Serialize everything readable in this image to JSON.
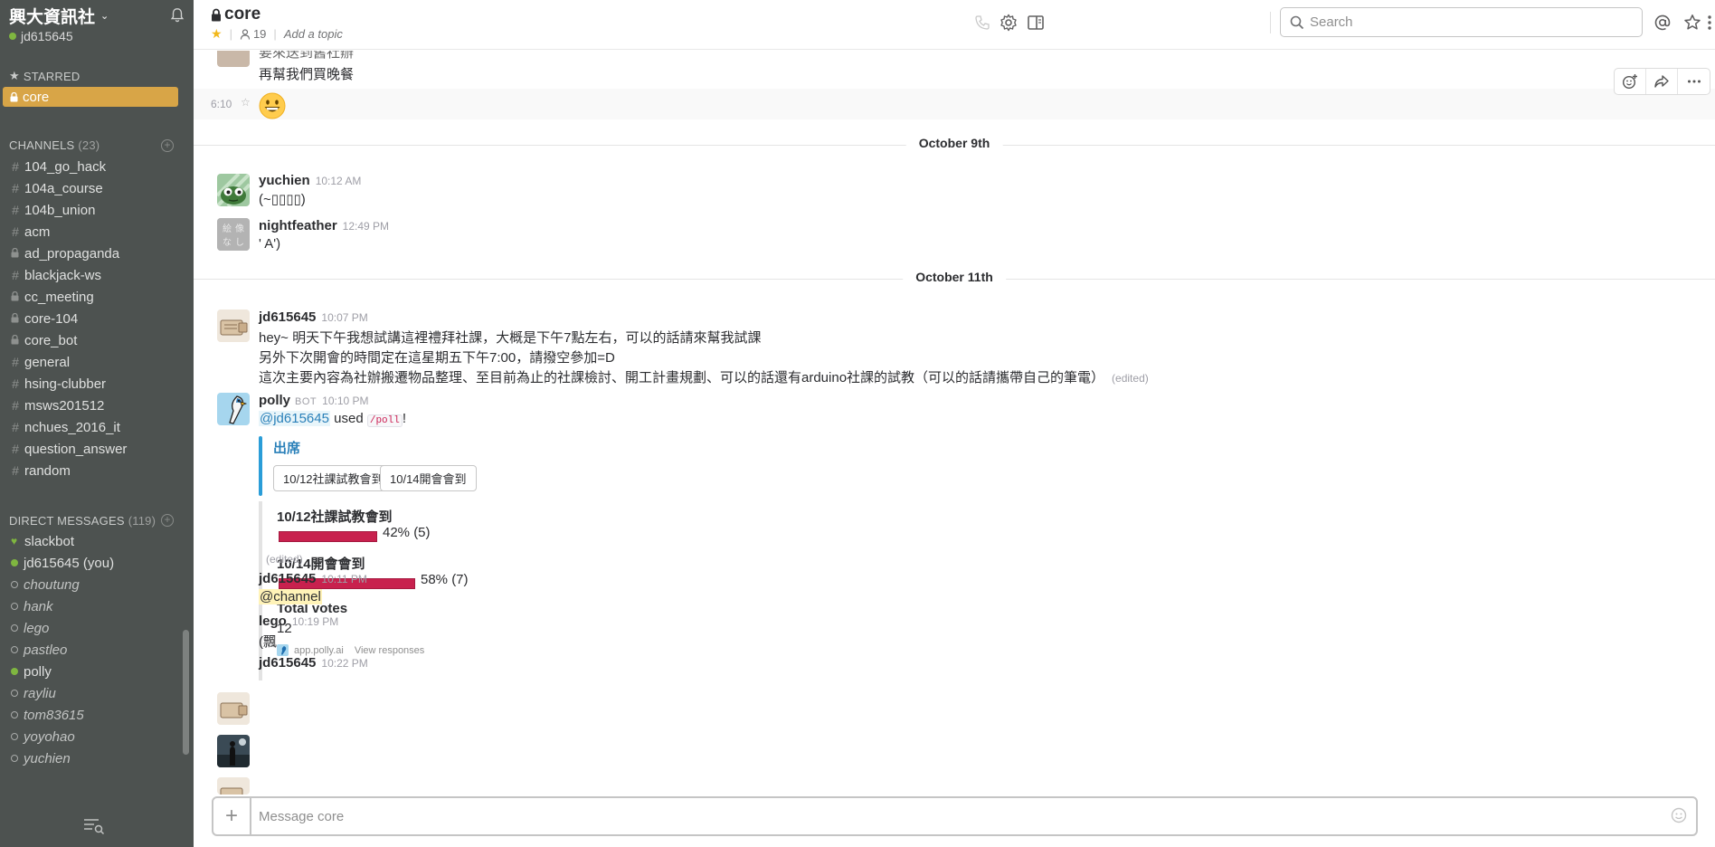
{
  "sidebar": {
    "team_name": "興大資訊社",
    "current_user": "jd615645",
    "starred_label": "STARRED",
    "starred_channel": "core",
    "channels_label": "CHANNELS",
    "channels_count": "(23)",
    "channels": [
      {
        "name": "104_go_hack",
        "private": false
      },
      {
        "name": "104a_course",
        "private": false
      },
      {
        "name": "104b_union",
        "private": false
      },
      {
        "name": "acm",
        "private": false
      },
      {
        "name": "ad_propaganda",
        "private": true
      },
      {
        "name": "blackjack-ws",
        "private": false
      },
      {
        "name": "cc_meeting",
        "private": true
      },
      {
        "name": "core-104",
        "private": true
      },
      {
        "name": "core_bot",
        "private": true
      },
      {
        "name": "general",
        "private": false
      },
      {
        "name": "hsing-clubber",
        "private": false
      },
      {
        "name": "msws201512",
        "private": false
      },
      {
        "name": "nchues_2016_it",
        "private": false
      },
      {
        "name": "question_answer",
        "private": false
      },
      {
        "name": "random",
        "private": false
      }
    ],
    "dm_label": "DIRECT MESSAGES",
    "dm_count": "(119)",
    "dms": [
      {
        "name": "slackbot",
        "status": "bot"
      },
      {
        "name": "jd615645 (you)",
        "status": "online"
      },
      {
        "name": "choutung",
        "status": "away"
      },
      {
        "name": "hank",
        "status": "away"
      },
      {
        "name": "lego",
        "status": "away"
      },
      {
        "name": "pastleo",
        "status": "away"
      },
      {
        "name": "polly",
        "status": "online"
      },
      {
        "name": "rayliu",
        "status": "away"
      },
      {
        "name": "tom83615",
        "status": "away"
      },
      {
        "name": "yoyohao",
        "status": "away"
      },
      {
        "name": "yuchien",
        "status": "away"
      }
    ]
  },
  "header": {
    "channel_name": "core",
    "member_count": "19",
    "topic_placeholder": "Add a topic",
    "search_placeholder": "Search"
  },
  "messages": {
    "top_partial_line1": "要來送到舊社辦",
    "top_partial_line2": "再幫我們買晚餐",
    "top_time": "6:10",
    "day1": "October 9th",
    "m1_author": "yuchien",
    "m1_time": "10:12 AM",
    "m1_text": "(~▯▯▯▯)",
    "m2_author": "nightfeather",
    "m2_time": "12:49 PM",
    "m2_text": "' A')",
    "day2": "October 11th",
    "m3_author": "jd615645",
    "m3_time": "10:07 PM",
    "m3_line1": "hey~ 明天下午我想試講這裡禮拜社課，大概是下午7點左右，可以的話請來幫我試課",
    "m3_line2": "另外下次開會的時間定在這星期五下午7:00，請撥空參加=D",
    "m3_line3": "這次主要內容為社辦搬遷物品整理、至目前為止的社課檢討、開工計畫規劃、可以的話還有arduino社課的試教（可以的話請攜帶自己的筆電）",
    "edited_label": "(edited)",
    "m4_author": "polly",
    "m4_bot": "BOT",
    "m4_time": "10:10 PM",
    "m4_mention": "@jd615645",
    "m4_used": "used",
    "m4_cmd": "/poll",
    "m4_bang": "!",
    "poll": {
      "title": "出席",
      "options": [
        "10/12社課試教會到",
        "10/14開會會到"
      ],
      "results": [
        {
          "label": "10/12社課試教會到",
          "pct_text": "42% (5)",
          "fraction": 0.42
        },
        {
          "label": "10/14開會會到",
          "pct_text": "58% (7)",
          "fraction": 0.58
        }
      ],
      "total_label": "Total votes",
      "total_value": "12",
      "footer_app": "app.polly.ai",
      "footer_link": "View responses"
    },
    "m4_edited": "(edited)",
    "m5_author": "jd615645",
    "m5_time": "10:11 PM",
    "m5_text": "@channel",
    "m6_author": "lego",
    "m6_time": "10:19 PM",
    "m6_text": "(飄",
    "m7_author": "jd615645",
    "m7_time": "10:22 PM"
  },
  "composer": {
    "placeholder": "Message core"
  },
  "colors": {
    "sidebar_bg": "#4d5250",
    "starred_highlight": "#d8a547",
    "online": "#7fb640",
    "poll_accent": "#2a9dd8",
    "poll_bar": "#c8214e"
  }
}
